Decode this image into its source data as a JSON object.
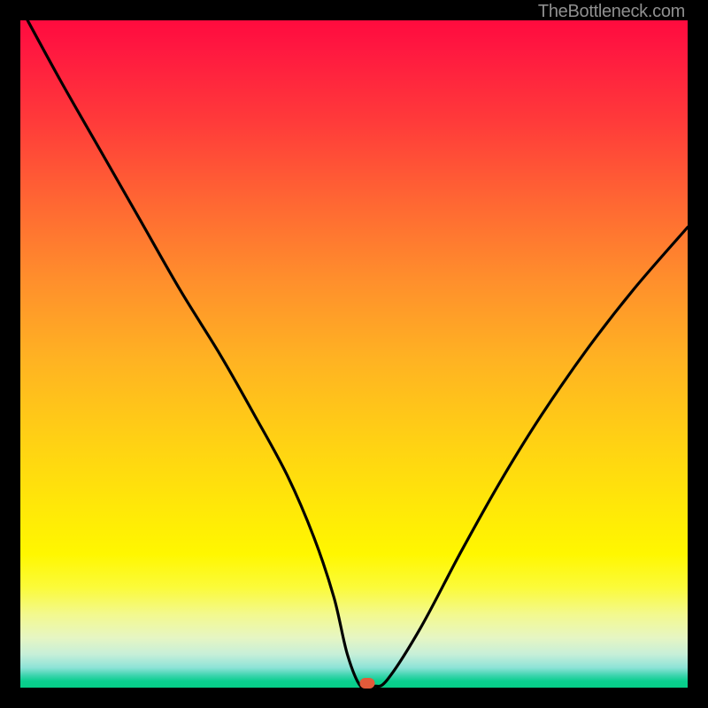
{
  "attribution": "TheBottleneck.com",
  "chart_data": {
    "type": "line",
    "title": "",
    "xlabel": "",
    "ylabel": "",
    "xlim": [
      0,
      100
    ],
    "ylim": [
      0,
      100
    ],
    "series": [
      {
        "name": "bottleneck-curve",
        "x": [
          0,
          6,
          12,
          18,
          24,
          30,
          35,
          40,
          44,
          47,
          49,
          51,
          53,
          55,
          60,
          66,
          72,
          78,
          85,
          92,
          100
        ],
        "y": [
          102,
          91,
          80.5,
          70,
          59.5,
          49.8,
          41,
          31.8,
          22.5,
          13.5,
          5,
          0.2,
          0.2,
          1.2,
          9,
          20.3,
          31,
          40.7,
          50.8,
          59.8,
          69
        ]
      }
    ],
    "marker": {
      "x": 52,
      "y": 0.6
    },
    "gradient_stops": [
      {
        "pct": 0,
        "color": "#ff0b3e"
      },
      {
        "pct": 15,
        "color": "#ff3a3a"
      },
      {
        "pct": 39,
        "color": "#ff8f2c"
      },
      {
        "pct": 63,
        "color": "#ffd114"
      },
      {
        "pct": 80,
        "color": "#fff700"
      },
      {
        "pct": 95,
        "color": "#c7efd8"
      },
      {
        "pct": 100,
        "color": "#06cd87"
      }
    ]
  }
}
